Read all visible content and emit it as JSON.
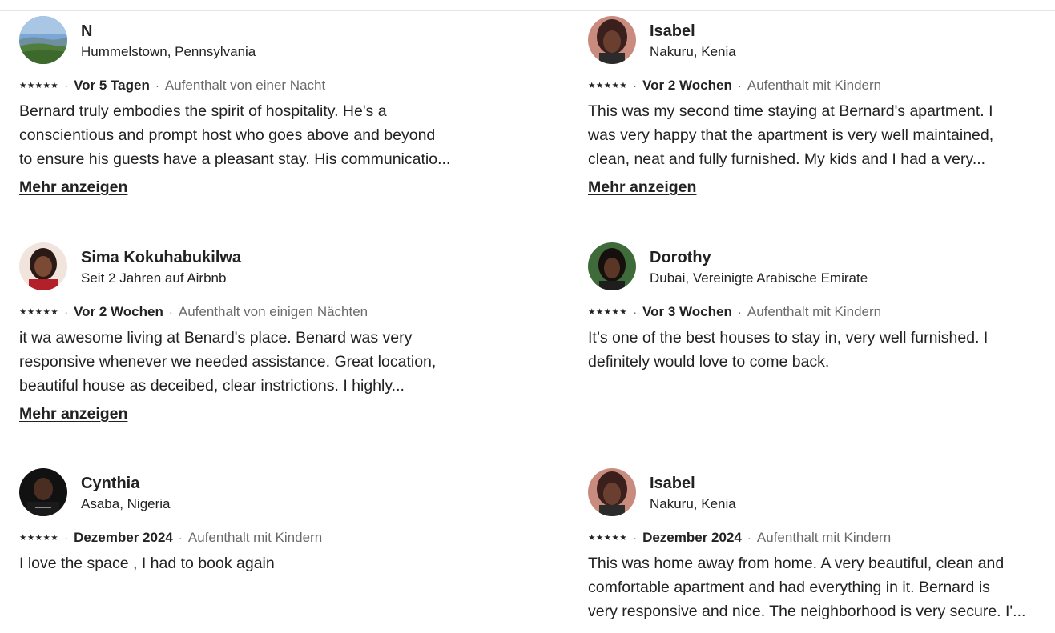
{
  "reviews": [
    {
      "name": "N",
      "location": "Hummelstown, Pennsylvania",
      "stars": "★★★★★",
      "when": "Vor 5 Tagen",
      "stay": "Aufenthalt von einer Nacht",
      "lines": [
        "Bernard truly embodies the spirit of hospitality. He's a",
        "conscientious and prompt host who goes above and beyond",
        "to ensure his guests have a pleasant stay. His communicatio..."
      ],
      "more": "Mehr anzeigen"
    },
    {
      "name": "Isabel",
      "location": "Nakuru, Kenia",
      "stars": "★★★★★",
      "when": "Vor 2 Wochen",
      "stay": "Aufenthalt mit Kindern",
      "lines": [
        "This was my second time staying at Bernard's apartment. I",
        "was very happy that the apartment is very well maintained,",
        "clean, neat and fully furnished. My kids and I had a very..."
      ],
      "more": "Mehr anzeigen"
    },
    {
      "name": "Sima Kokuhabukilwa",
      "location": "Seit 2 Jahren auf Airbnb",
      "stars": "★★★★★",
      "when": "Vor 2 Wochen",
      "stay": "Aufenthalt von einigen Nächten",
      "lines": [
        "it wa awesome living at Benard's place. Benard was very",
        "responsive whenever we needed assistance. Great location,",
        "beautiful house as deceibed, clear instrictions. I highly..."
      ],
      "more": "Mehr anzeigen"
    },
    {
      "name": "Dorothy",
      "location": "Dubai, Vereinigte Arabische Emirate",
      "stars": "★★★★★",
      "when": "Vor 3 Wochen",
      "stay": "Aufenthalt mit Kindern",
      "lines": [
        "It’s one of the best houses to stay in, very well furnished. I",
        "definitely would love to come back."
      ]
    },
    {
      "name": "Cynthia",
      "location": "Asaba, Nigeria",
      "stars": "★★★★★",
      "when": "Dezember 2024",
      "stay": "Aufenthalt mit Kindern",
      "lines": [
        "I love the space , I had to book again"
      ]
    },
    {
      "name": "Isabel",
      "location": "Nakuru, Kenia",
      "stars": "★★★★★",
      "when": "Dezember 2024",
      "stay": "Aufenthalt mit Kindern",
      "lines": [
        "This was home away from home. A very beautiful, clean and",
        "comfortable apartment and had everything in it. Bernard is",
        "very responsive and nice. The neighborhood is very secure. I'..."
      ]
    }
  ],
  "separator": "·"
}
